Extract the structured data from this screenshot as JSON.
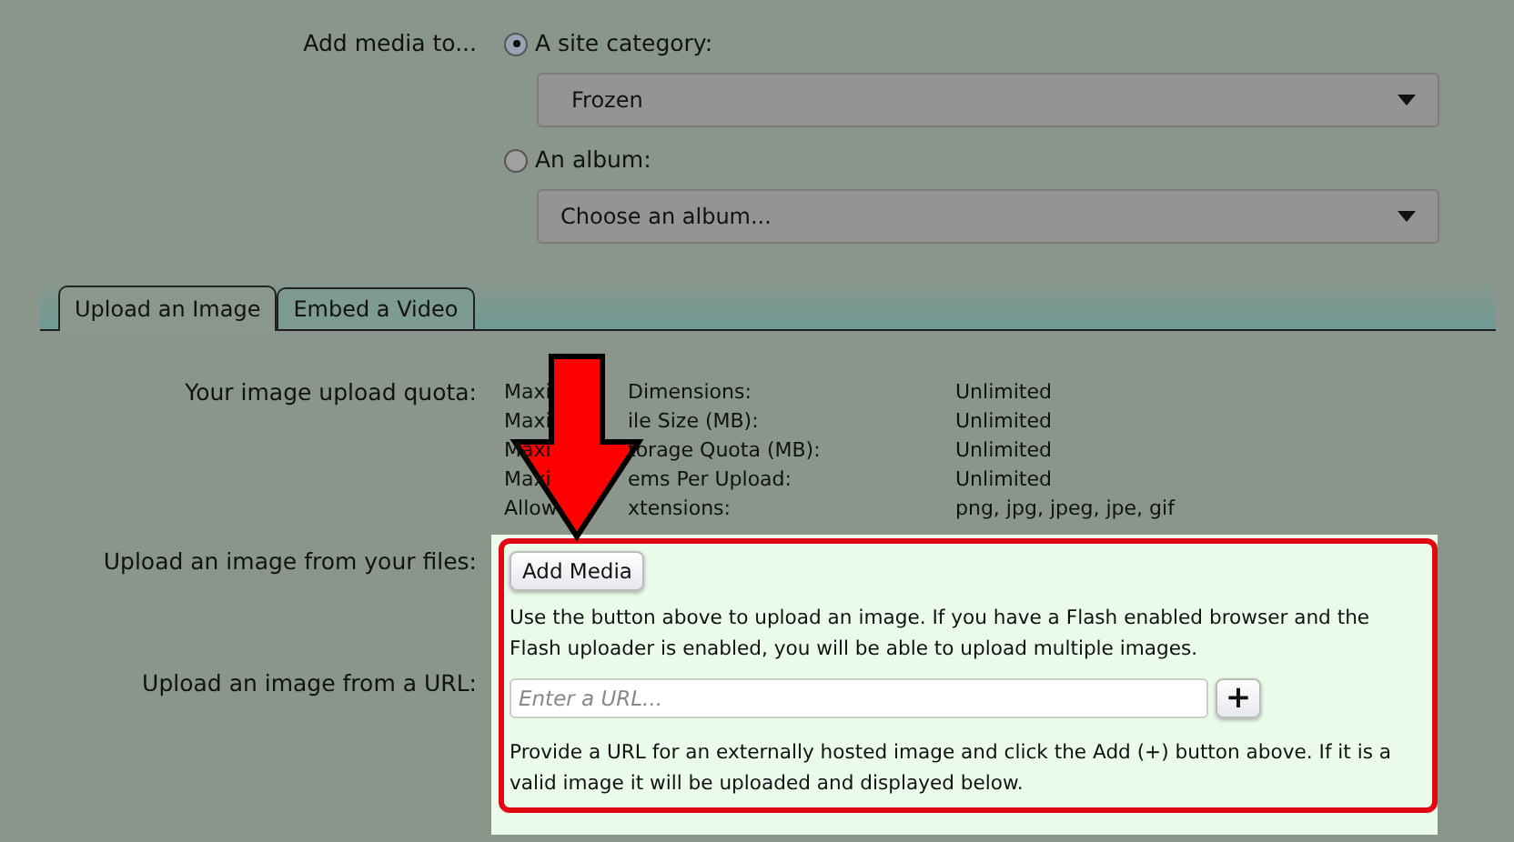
{
  "add_media_to": {
    "label": "Add media to...",
    "options": [
      {
        "label": "A site category:",
        "selected": true,
        "dropdown": "Frozen"
      },
      {
        "label": "An album:",
        "selected": false,
        "dropdown": "Choose an album..."
      }
    ]
  },
  "tabs": [
    {
      "label": "Upload an Image",
      "selected": true
    },
    {
      "label": "Embed a Video",
      "selected": false
    }
  ],
  "quota": {
    "label": "Your image upload quota:",
    "rows": [
      {
        "name_start": "Maxi",
        "name_end": "Dimensions:",
        "value": "Unlimited"
      },
      {
        "name_start": "Maxi",
        "name_end": "ile Size (MB):",
        "value": "Unlimited"
      },
      {
        "name_start": "Maxi",
        "name_end": "torage Quota (MB):",
        "value": "Unlimited"
      },
      {
        "name_start": "Maxi",
        "name_end": "ems Per Upload:",
        "value": "Unlimited"
      },
      {
        "name_start": "Allow",
        "name_end": "xtensions:",
        "value": "png, jpg, jpeg, jpe, gif"
      }
    ]
  },
  "upload_files": {
    "label": "Upload an image from your files:",
    "button": "Add Media",
    "help": "Use the button above to upload an image. If you have a Flash enabled browser and the Flash uploader is enabled, you will be able to upload multiple images."
  },
  "upload_url": {
    "label": "Upload an image from a URL:",
    "placeholder": "Enter a URL...",
    "add_button": "+",
    "help": "Provide a URL for an externally hosted image and click the Add (+) button above. If it is a valid image it will be uploaded and displayed below."
  }
}
